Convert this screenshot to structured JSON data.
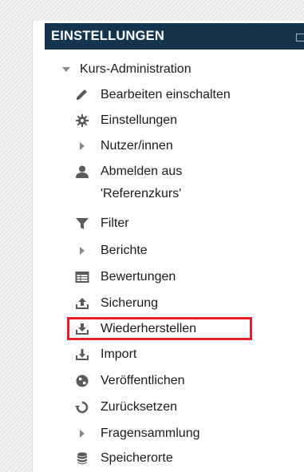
{
  "block": {
    "title": "EINSTELLUNGEN"
  },
  "tree": {
    "root_label": "Kurs-Administration",
    "items": [
      {
        "label": "Bearbeiten einschalten",
        "icon": "pencil-icon"
      },
      {
        "label": "Einstellungen",
        "icon": "gear-icon"
      },
      {
        "label": "Nutzer/innen",
        "icon": "expand-arrow-icon"
      },
      {
        "label": "Abmelden aus",
        "label2": "'Referenzkurs'",
        "icon": "user-icon"
      },
      {
        "label": "Filter",
        "icon": "filter-icon"
      },
      {
        "label": "Berichte",
        "icon": "expand-arrow-icon"
      },
      {
        "label": "Bewertungen",
        "icon": "grades-table-icon"
      },
      {
        "label": "Sicherung",
        "icon": "backup-upload-icon"
      },
      {
        "label": "Wiederherstellen",
        "icon": "restore-download-icon"
      },
      {
        "label": "Import",
        "icon": "import-icon"
      },
      {
        "label": "Veröffentlichen",
        "icon": "globe-icon"
      },
      {
        "label": "Zurücksetzen",
        "icon": "reset-icon"
      },
      {
        "label": "Fragensammlung",
        "icon": "expand-arrow-icon"
      },
      {
        "label": "Speicherorte",
        "icon": "database-icon"
      }
    ]
  },
  "colors": {
    "header_bg": "#15354f",
    "highlight": "#e8222a",
    "icon": "#5a5a5a"
  }
}
